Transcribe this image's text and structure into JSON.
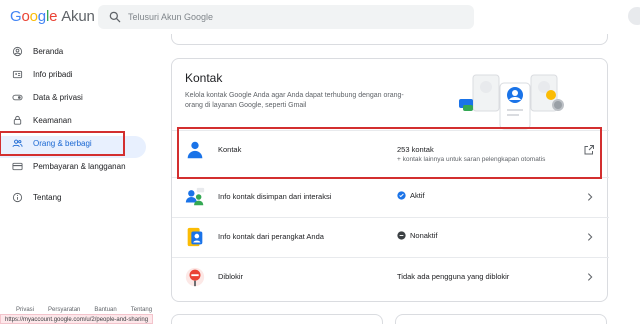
{
  "header": {
    "logo_google": "Google",
    "logo_product": "Akun",
    "search_placeholder": "Telusuri Akun Google"
  },
  "sidebar": {
    "items": [
      {
        "label": "Beranda",
        "icon": "home-icon"
      },
      {
        "label": "Info pribadi",
        "icon": "id-card-icon"
      },
      {
        "label": "Data & privasi",
        "icon": "toggle-icon"
      },
      {
        "label": "Keamanan",
        "icon": "lock-icon"
      },
      {
        "label": "Orang & berbagi",
        "icon": "people-icon"
      },
      {
        "label": "Pembayaran & langganan",
        "icon": "credit-card-icon"
      },
      {
        "label": "Tentang",
        "icon": "info-icon"
      }
    ],
    "active_index": 4
  },
  "footer": {
    "links": [
      "Privasi",
      "Persyaratan",
      "Bantuan",
      "Tentang"
    ]
  },
  "status_url": "https://myaccount.google.com/u/2/people-and-sharing",
  "contacts_card": {
    "title": "Kontak",
    "description": "Kelola kontak Google Anda agar Anda dapat terhubung dengan orang-orang di layanan Google, seperti Gmail",
    "rows": [
      {
        "label": "Kontak",
        "value": "253 kontak",
        "value2": "+ kontak lainnya untuk saran pelengkapan otomatis",
        "action_icon": "open-external-icon"
      },
      {
        "label": "Info kontak disimpan dari interaksi",
        "status": "Aktif",
        "status_icon": "check-circle-icon",
        "action_icon": "chevron-right-icon"
      },
      {
        "label": "Info kontak dari perangkat Anda",
        "status": "Nonaktif",
        "status_icon": "minus-circle-icon",
        "action_icon": "chevron-right-icon"
      },
      {
        "label": "Diblokir",
        "value": "Tidak ada pengguna yang diblokir",
        "action_icon": "chevron-right-icon"
      }
    ]
  },
  "colors": {
    "accent": "#1a73e8",
    "active_bg": "#e8f0fe",
    "highlight": "#d32f2f",
    "active_status": "#1e8e3e"
  }
}
